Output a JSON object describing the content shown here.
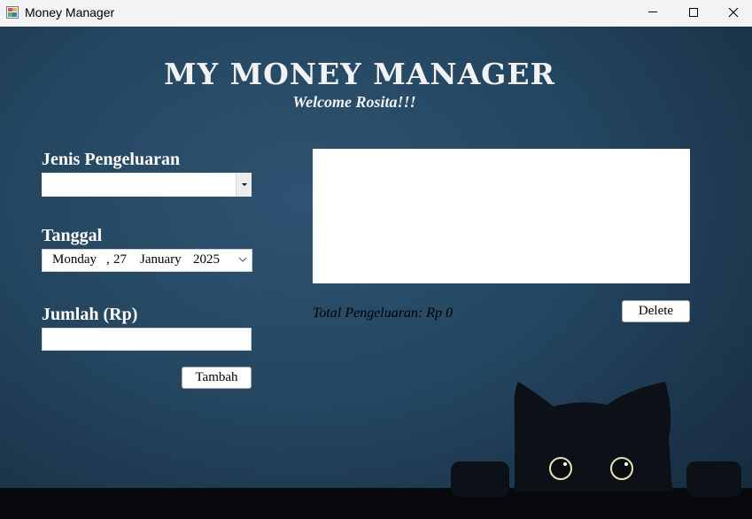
{
  "window": {
    "title": "Money Manager",
    "controls": [
      "minimize",
      "maximize",
      "close"
    ]
  },
  "header": {
    "title": "My Money Manager",
    "welcome": "Welcome Rosita!!!"
  },
  "form": {
    "category_label": "Jenis Pengeluaran",
    "category_value": "",
    "date_label": "Tanggal",
    "date": {
      "weekday": "Monday",
      "sep": ",",
      "day": "27",
      "month": "January",
      "year": "2025"
    },
    "amount_label": "Jumlah (Rp)",
    "amount_value": "",
    "add_button": "Tambah"
  },
  "expenses": {
    "items": [],
    "total_label": "Total Pengeluaran: Rp 0",
    "delete_button": "Delete"
  },
  "colors": {
    "background_top": "#2e5372",
    "background_bottom": "#14283a",
    "floor": "#07090d",
    "cat_eyes": "#e8e3b2"
  },
  "icons": [
    "app-icon",
    "minimize-icon",
    "maximize-icon",
    "close-icon",
    "dropdown-arrow-icon",
    "chevron-down-icon",
    "cat-illustration"
  ]
}
